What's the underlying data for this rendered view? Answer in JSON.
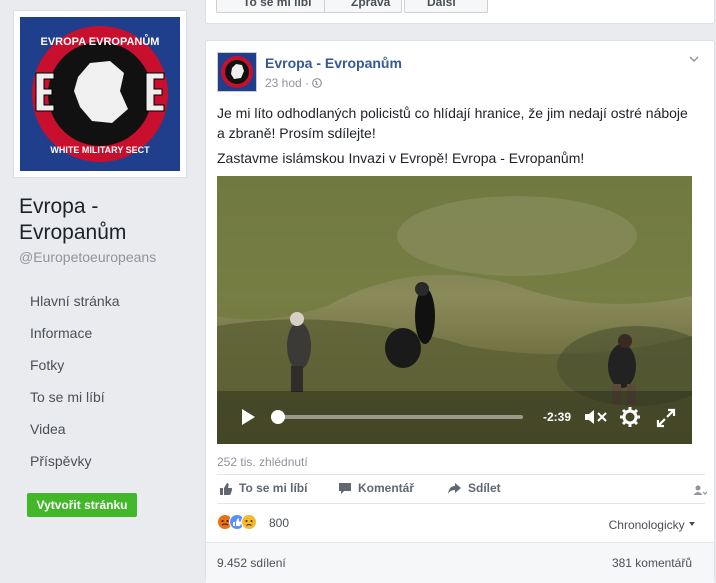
{
  "page": {
    "name": "Evropa - Evropanům",
    "handle": "@Europetoeuropeans",
    "logo_text_top": "EVROPA EVROPANŮM",
    "logo_text_bottom": "WHITE MILITARY SECT"
  },
  "topbar": {
    "like_label": "To se mi líbí",
    "message_label": "Zpráva",
    "more_label": "Další"
  },
  "nav": {
    "items": [
      {
        "label": "Hlavní stránka"
      },
      {
        "label": "Informace"
      },
      {
        "label": "Fotky"
      },
      {
        "label": "To se mi líbí"
      },
      {
        "label": "Videa"
      },
      {
        "label": "Příspěvky"
      }
    ]
  },
  "create_page_label": "Vytvořit stránku",
  "post": {
    "author": "Evropa - Evropanům",
    "time": "23 hod",
    "text1": "Je mi líto odhodlaných policistů co hlídají hranice, že jim nedají ostré náboje a zbraně! Prosím sdílejte!",
    "text2": "Zastavme islámskou Invazi v Evropě! Evropa - Evropanům!",
    "video": {
      "time_remaining": "-2:39",
      "progress": 0.02
    },
    "views": "252 tis. zhlédnutí",
    "actions": {
      "like": "To se mi líbí",
      "comment": "Komentář",
      "share": "Sdílet"
    },
    "reactions": {
      "count": "800",
      "types": [
        "angry",
        "like",
        "sad"
      ]
    },
    "sort_label": "Chronologicky",
    "shares": "9.452 sdílení",
    "comments": "381 komentářů"
  },
  "colors": {
    "brand": "#365899",
    "create_button": "#42b72a",
    "logo_blue": "#1f3e8c",
    "logo_red": "#c8102e"
  }
}
